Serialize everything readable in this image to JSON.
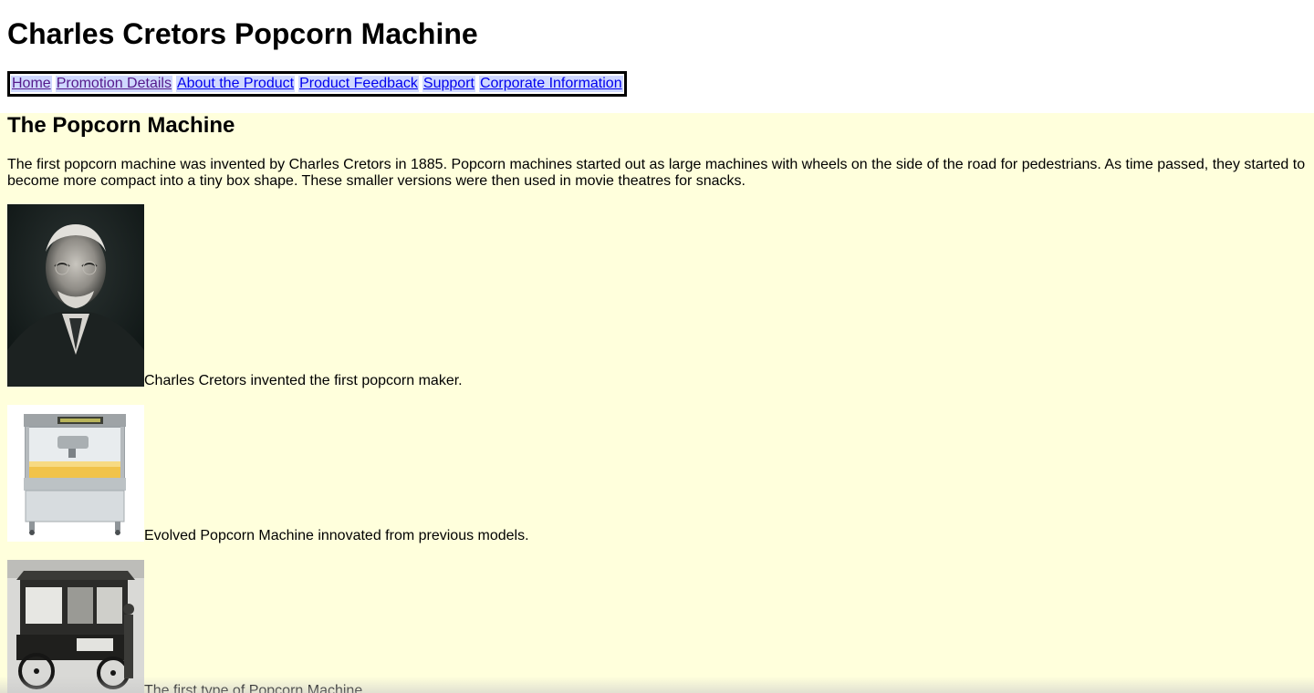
{
  "header": {
    "title": "Charles Cretors Popcorn Machine"
  },
  "nav": {
    "items": [
      {
        "label": "Home"
      },
      {
        "label": "Promotion Details"
      },
      {
        "label": "About the Product"
      },
      {
        "label": "Product Feedback"
      },
      {
        "label": "Support"
      },
      {
        "label": "Corporate Information"
      }
    ]
  },
  "main": {
    "heading": "The Popcorn Machine",
    "intro": "The first popcorn machine was invented by Charles Cretors in 1885. Popcorn machines started out as large machines with wheels on the side of the road for pedestrians. As time passed, they started to become more compact into a tiny box shape. These smaller versions were then used in movie theatres for snacks.",
    "figures": [
      {
        "caption": "Charles Cretors invented the first popcorn maker."
      },
      {
        "caption": "Evolved Popcorn Machine innovated from previous models."
      },
      {
        "caption": "The first type of Popcorn Machine"
      }
    ]
  },
  "colors": {
    "content_bg": "#ffffdc",
    "nav_link_bg": "#cfd8ff",
    "link": "#0000ee",
    "visited_link": "#551a8b"
  }
}
